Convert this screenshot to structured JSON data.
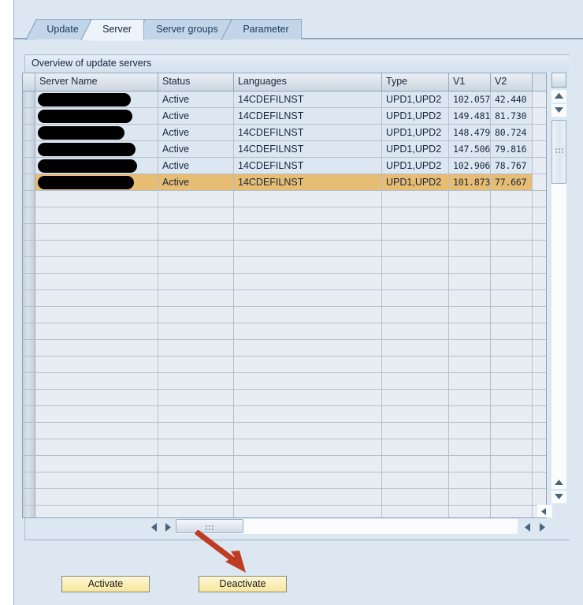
{
  "window": {
    "title": "Overview of update servers"
  },
  "tabs": [
    {
      "label": "Update",
      "active": false
    },
    {
      "label": "Server",
      "active": true
    },
    {
      "label": "Server groups",
      "active": false
    },
    {
      "label": "Parameter",
      "active": false
    }
  ],
  "grid": {
    "columns": [
      {
        "key": "server_name",
        "label": "Server Name"
      },
      {
        "key": "status",
        "label": "Status"
      },
      {
        "key": "languages",
        "label": "Languages"
      },
      {
        "key": "type",
        "label": "Type"
      },
      {
        "key": "v1",
        "label": "V1"
      },
      {
        "key": "v2",
        "label": "V2"
      }
    ],
    "rows": [
      {
        "server_name": "",
        "redacted": true,
        "redact_width": 118,
        "status": "Active",
        "languages": "14CDEFILNST",
        "type": "UPD1,UPD2",
        "v1": "102.057",
        "v2": "42.440",
        "selected": false
      },
      {
        "server_name": "",
        "redacted": true,
        "redact_width": 120,
        "status": "Active",
        "languages": "14CDEFILNST",
        "type": "UPD1,UPD2",
        "v1": "149.481",
        "v2": "81.730",
        "selected": false
      },
      {
        "server_name": "",
        "redacted": true,
        "redact_width": 110,
        "status": "Active",
        "languages": "14CDEFILNST",
        "type": "UPD1,UPD2",
        "v1": "148.479",
        "v2": "80.724",
        "selected": false
      },
      {
        "server_name": "",
        "redacted": true,
        "redact_width": 124,
        "status": "Active",
        "languages": "14CDEFILNST",
        "type": "UPD1,UPD2",
        "v1": "147.506",
        "v2": "79.816",
        "selected": false
      },
      {
        "server_name": "",
        "redacted": true,
        "redact_width": 126,
        "status": "Active",
        "languages": "14CDEFILNST",
        "type": "UPD1,UPD2",
        "v1": "102.906",
        "v2": "78.767",
        "selected": false
      },
      {
        "server_name": "",
        "redacted": true,
        "redact_width": 122,
        "status": "Active",
        "languages": "14CDEFILNST",
        "type": "UPD1,UPD2",
        "v1": "101.873",
        "v2": "77.667",
        "selected": true
      }
    ],
    "empty_row_count": 20,
    "selected_row_index": 5
  },
  "scrollbars": {
    "vertical": {
      "up_icon": "triangle-up-icon",
      "down_icon": "triangle-down-icon",
      "grip_icon": "grip-dots-icon"
    },
    "horizontal": {
      "left_icon": "triangle-left-icon",
      "right_icon": "triangle-right-icon",
      "grip_icon": "grip-dots-icon"
    }
  },
  "buttons": {
    "activate": "Activate",
    "deactivate": "Deactivate"
  },
  "annotation": {
    "arrow_color": "#bf3c23",
    "points_to": "Deactivate"
  },
  "colors": {
    "accent": "#dce7f2",
    "row_filled": "#dde7f1",
    "row_empty": "#e8edf4",
    "row_selected": "#e7bd74",
    "button": "#faeeb4",
    "focus_bracket": "#cc0000",
    "annotation": "#bf3c23"
  }
}
